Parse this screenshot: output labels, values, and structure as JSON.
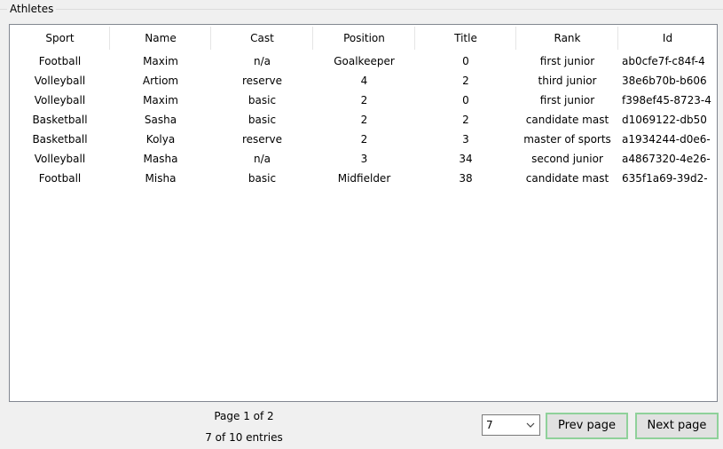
{
  "group": {
    "title": "Athletes"
  },
  "table": {
    "columns": [
      "Sport",
      "Name",
      "Cast",
      "Position",
      "Title",
      "Rank",
      "Id"
    ],
    "rows": [
      [
        "Football",
        "Maxim",
        "n/a",
        "Goalkeeper",
        "0",
        "first junior",
        "ab0cfe7f-c84f-4"
      ],
      [
        "Volleyball",
        "Artiom",
        "reserve",
        "4",
        "2",
        "third junior",
        "38e6b70b-b606"
      ],
      [
        "Volleyball",
        "Maxim",
        "basic",
        "2",
        "0",
        "first junior",
        "f398ef45-8723-4"
      ],
      [
        "Basketball",
        "Sasha",
        "basic",
        "2",
        "2",
        "candidate mast",
        "d1069122-db50"
      ],
      [
        "Basketball",
        "Kolya",
        "reserve",
        "2",
        "3",
        "master of sports",
        "a1934244-d0e6-"
      ],
      [
        "Volleyball",
        "Masha",
        "n/a",
        "3",
        "34",
        "second junior",
        "a4867320-4e26-"
      ],
      [
        "Football",
        "Misha",
        "basic",
        "Midfielder",
        "38",
        "candidate mast",
        "635f1a69-39d2-"
      ]
    ]
  },
  "footer": {
    "page_info": "Page 1 of 2",
    "entries_info": "7 of 10 entries",
    "page_size_value": "7",
    "prev_label": "Prev page",
    "next_label": "Next page"
  }
}
